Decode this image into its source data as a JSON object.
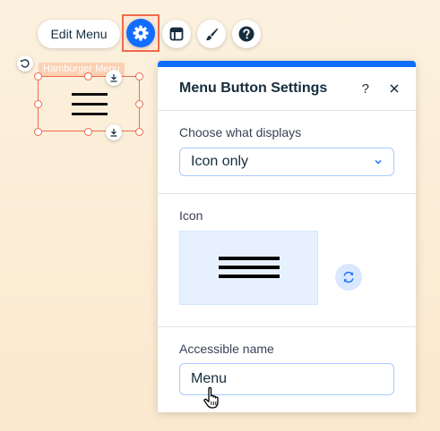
{
  "toolbar": {
    "edit_menu_label": "Edit Menu",
    "settings_icon": "gear-icon",
    "layout_icon": "layout-icon",
    "design_icon": "brush-icon",
    "help_icon": "help-icon"
  },
  "element": {
    "label": "Hamburger Menu",
    "icon": "hamburger-icon"
  },
  "panel": {
    "title": "Menu Button Settings",
    "help": "?",
    "display": {
      "label": "Choose what displays",
      "selected": "Icon only"
    },
    "icon": {
      "label": "Icon",
      "preview": "hamburger-icon",
      "change_icon": "refresh-icon"
    },
    "accessible_name": {
      "label": "Accessible name",
      "value": "Menu"
    }
  },
  "colors": {
    "accent": "#116dff",
    "selection": "#ef6b4a",
    "canvas": "#fbeeda"
  }
}
